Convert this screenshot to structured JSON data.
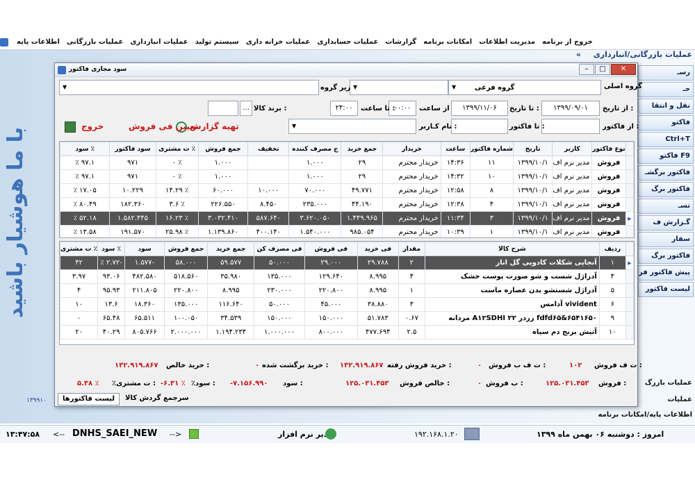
{
  "menu": {
    "items": [
      "اطلاعات پایه",
      "عملیات بازرگانی",
      "عملیات انبارداری",
      "سیستم تولید",
      "عملیات خزانه داری",
      "عملیات حسابداری",
      "گزارشات",
      "امکانات برنامه",
      "مدیریت اطلاعات",
      "خروج از برنامه"
    ]
  },
  "sidebar": {
    "title": "عملیات بازرگانی/انبارداری",
    "collapse_glyph": "«",
    "buttons": [
      "رسـ",
      "حـ",
      "نقل و انتقا",
      "فاکتو",
      "Ctrl+T",
      "F9 فاکتو",
      "فاکتور برگشـ",
      "فاکتور برگ",
      "تسـ",
      "گـزارش ف",
      "سفار",
      "فاکتور برگ",
      "پیش فاکتور فرو",
      "لیست فاکتور"
    ]
  },
  "slogan": "با ما هوشیار باشید",
  "bottom_left_number": "۱۳۹۹۱۰",
  "bottom_links": [
    "عملیات بازرگ",
    "عملیات",
    "اطلاعات پایه/امکانات برنامه"
  ],
  "statusbar": {
    "time": "۱۳:۴۷:۵۸",
    "arrow_left": "<--",
    "db_name": "DNHS_SAEI_NEW",
    "arrow_right": "-->",
    "user": "مدیر نرم افزار",
    "ip": "۱۹۲.۱۶۸.۱.۲۰",
    "date": "امروز : دوشنبه ۰۶ بهمن ماه ۱۳۹۹"
  },
  "dialog": {
    "title": "سود مجازی فاکتور",
    "filters": {
      "main_group_label": "گروه اصلی",
      "sub_group_label": "گروه فرعی",
      "subgroup_label": "زیر گروه",
      "from_date_label": "از تاریخ :",
      "from_date_value": "۱۳۹۹/۰۹/۰۱",
      "to_date_label": "تا تاریخ :",
      "to_date_value": "۱۳۹۹/۱۱/۰۶",
      "from_time_label": "از ساعت",
      "from_time_value": "۰۰:۰۰",
      "to_time_label": "تا ساعت :",
      "to_time_value": "۲۴:۰۰",
      "brand_label": "برند کالا :",
      "brand_button": "...",
      "from_invoice_label": "از فاکتور :",
      "to_invoice_label": "تا فاکتور :",
      "username_label": "نام کـاربر :"
    },
    "actions": {
      "report": "تهیه گزارش",
      "set_price": "تعیین فی فروش",
      "exit": "خروج"
    },
    "invoices": {
      "headers": [
        "نوع فاکتور",
        "کاربر",
        "تاریخ",
        "شماره فاکتور",
        "ساعت",
        "خریدار",
        "جمع خرید",
        "ج مصرف کننده",
        "تخفیف",
        "جمع فروش",
        "٪ ت مشتری",
        "سود فاکتور",
        "٪ سود"
      ],
      "rows": [
        [
          "فروش",
          "مدیر نرم اف",
          "۱۳۹۹/۱۰/۱",
          "۱۱",
          "۱۴:۳۶",
          "خریدار محترم",
          "۲۹",
          "۱.۰۰۰",
          "",
          "۱.۰۰۰",
          "٪ ۰",
          "۹۷۱",
          "۹۷.۱ ٪"
        ],
        [
          "فروش",
          "مدیر نرم اف",
          "۱۳۹۹/۱۰/۱",
          "۱۰",
          "۱۴:۳۲",
          "خریدار محترم",
          "۲۹",
          "۱.۰۰۰",
          "",
          "۱.۰۰۰",
          "٪ ۰",
          "۹۷۱",
          "۹۷.۱ ٪"
        ],
        [
          "فروش",
          "مدیر نرم اف",
          "۱۳۹۹/۱۰/۱",
          "۸",
          "۱۲:۵۸",
          "خریدار محترم",
          "۴۹.۷۷۱",
          "۷۰.۰۰۰",
          "۱۰.۰۰۰",
          "۶۰.۰۰۰",
          "٪ ۱۴.۲۹",
          "۱۰.۲۲۹",
          "۱۷.۰۵ ٪"
        ],
        [
          "فروش",
          "مدیر نرم اف",
          "۱۳۹۹/۱۰/۱",
          "۴",
          "۱۲:۳۸",
          "خریدار محترم",
          "۴۴.۱۹۰",
          "۲۳۵.۰۰۰",
          "۸.۴۵۰",
          "۲۲۶.۵۵۰",
          "٪ ۳.۶",
          "۱۸۲.۳۶۰",
          "۸۰.۴۹ ٪"
        ],
        [
          "فروش",
          "مدیر نرم اف",
          "۱۳۹۹/۱۰/۱",
          "۳",
          "۱۱:۳۴",
          "خریدار محترم",
          "۱.۴۴۹.۹۶۵",
          "۳.۶۲۰.۰۵۰",
          "۵۸۷.۶۴۰",
          "۳.۰۳۲.۴۱۰",
          "٪ ۱۶.۲۳",
          "۱.۵۸۲.۴۴۵",
          "۵۲.۱۸ ٪"
        ],
        [
          "فروش",
          "مدیر نرم اف",
          "۱۳۹۹/۱۰/۱",
          "۱",
          "۱۰:۳۹",
          "خریدار محترم",
          "۹۸۵.۰۵۴",
          "۱.۵۴۰.۰۰۰",
          "۴۰۰.۱۴۰",
          "۱.۱۳۹.۸۶۰",
          "٪ ۲۵.۹۸",
          "۱۹۱.۵۷۰",
          "۱۳.۵۸ ٪"
        ]
      ],
      "selected_index": 4
    },
    "items": {
      "headers": [
        "ردیف",
        "شرح کالا",
        "مقدار",
        "فی خرید",
        "فی فروش",
        "فی مصرف کن",
        "جمع خرید",
        "جمع فروش",
        "سود",
        "٪ سود",
        "٪ ت مشتری"
      ],
      "rows": [
        [
          "۱",
          "آنجاپی شکلات کادویی گل انار",
          "۲",
          "۲۹.۷۸۸",
          "۲۹.۰۰۰",
          "۵۰.۰۰۰",
          "۵۹.۵۷۷",
          "۵۸.۰۰۰",
          "-۱.۵۷۷",
          "-۲.۷۲ ٪",
          "۴۲"
        ],
        [
          "۴",
          "آدراژل شست و شو صورت پوست خشک",
          "۴",
          "۸.۹۹۵",
          "۱۲۹.۶۴۰",
          "۱۳۵.۰۰۰",
          "۳۵.۹۸۰",
          "۵۱۸.۵۶۰",
          "۴۸۲.۵۸۰",
          "۹۳.۰۶",
          "۳.۹۷"
        ],
        [
          "۵",
          "آدراژل شستشو بدن عصاره ماست",
          "۱",
          "۸.۹۹۵",
          "۲۲۰.۸۰۰",
          "۲۳۰.۰۰۰",
          "۸.۹۹۵",
          "۲۲۰.۸۰۰",
          "۲۱۱.۸۰۵",
          "۹۵.۹۳",
          "۴"
        ],
        [
          "۶",
          "vivident آدامس",
          "۳",
          "۳۸.۸۸۰",
          "۴۵.۰۰۰",
          "۵۰.۰۰۰",
          "۱۱۶.۶۴۰",
          "۱۳۵.۰۰۰",
          "۱۸.۳۶۰",
          "۱۳.۶",
          "۱۰"
        ],
        [
          "۹",
          "fdfd۶۵&۶۵۴۱۶۵۰ زردر ۲۲ A۱۲SDHI مردانه",
          "۰.۶۷",
          "۵۱.۷۸۳",
          "۱۵۰.۰۰۰",
          "۱۵۰.۰۰۰",
          "۳۴.۵۳۹",
          "۱۰۰.۰۵۰",
          "۶۵.۵۱۱",
          "۶۵.۴۸",
          "۰"
        ],
        [
          "۱۰",
          "آتیش برنج دم سیاه",
          "۲.۵",
          "۴۷۷.۶۹۴",
          "۸۰۰.۰۰۰",
          "۱.۰۰۰.۰۰۰",
          "۱.۱۹۴.۲۳۴",
          "۲.۰۰۰.۰۰۰",
          "۸۰۵.۷۶۶",
          "۴۰.۲۹",
          "۲۰"
        ]
      ],
      "selected_index": 0
    },
    "summary": {
      "tf_sales_count_label": "ت ف فروش :",
      "tf_sales_count_value": "۱۰۲",
      "tfb_sales_label": "ت ف ب فروش :",
      "tfb_sales_value": "۰",
      "sold_purchase_label": "خرید فروش رفته :",
      "sold_purchase_value": "۱۳۲.۹۱۹.۸۶۷",
      "returned_purchase_label": "خرید برگشت شده :",
      "returned_purchase_value": "۰",
      "net_purchase_label": "خرید خالص :",
      "net_purchase_value": "۱۳۲.۹۱۹.۸۶۷",
      "sales_label": "فروش :",
      "sales_value": "۱۲۵.۰۳۱.۴۵۳",
      "b_sales_label": "ب فروش :",
      "b_sales_value": "۰",
      "net_sales_label": "خالص فروش :",
      "net_sales_value": "۱۲۵.۰۳۱.۴۵۳",
      "profit_label": "سود :",
      "profit_value": "-۷.۱۵۶.۹۹۰",
      "profit_pct_label": "٪سود :",
      "profit_pct_value": "-۶.۳۱ ٪",
      "customer_disc_label": "٪ت مشتری :",
      "customer_disc_value": "۵.۳۸ ٪"
    },
    "tabs": {
      "invoices": "لیست فاکتورها",
      "goods_turnover": "سرجمع گردش کالا"
    }
  }
}
